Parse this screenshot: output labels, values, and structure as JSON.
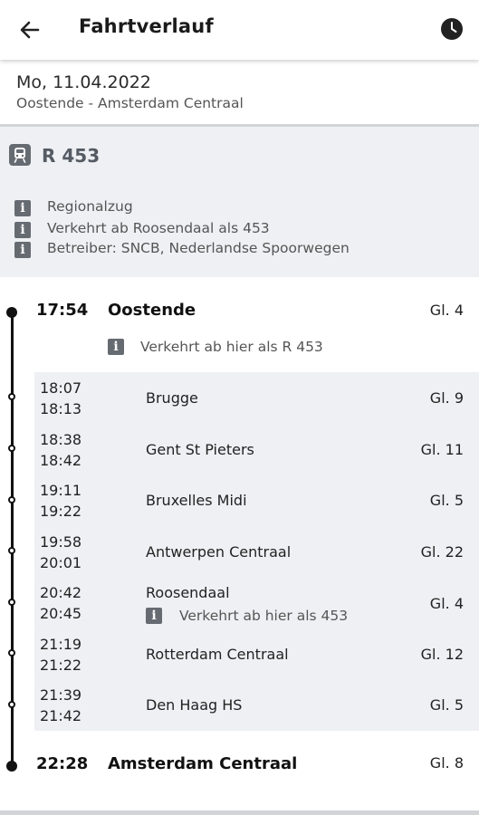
{
  "header": {
    "title": "Fahrtverlauf",
    "back_icon": "arrow-left-icon",
    "history_icon": "clock-icon"
  },
  "journey": {
    "date": "Mo, 11.04.2022",
    "route": "Oostende - Amsterdam Centraal"
  },
  "train": {
    "name": "R 453",
    "icon": "train-icon",
    "infos": [
      "Regionalzug",
      "Verkehrt ab Roosendaal als 453",
      "Betreiber: SNCB, Nederlandse Spoorwegen"
    ]
  },
  "origin": {
    "time": "17:54",
    "station": "Oostende",
    "track": "Gl. 4",
    "note": "Verkehrt ab hier als R 453"
  },
  "stops": [
    {
      "arr": "18:07",
      "dep": "18:13",
      "station": "Brugge",
      "track": "Gl. 9"
    },
    {
      "arr": "18:38",
      "dep": "18:42",
      "station": "Gent St Pieters",
      "track": "Gl. 11"
    },
    {
      "arr": "19:11",
      "dep": "19:22",
      "station": "Bruxelles Midi",
      "track": "Gl. 5"
    },
    {
      "arr": "19:58",
      "dep": "20:01",
      "station": "Antwerpen Centraal",
      "track": "Gl. 22"
    },
    {
      "arr": "20:42",
      "dep": "20:45",
      "station": "Roosendaal",
      "track": "Gl. 4",
      "note": "Verkehrt ab hier als 453"
    },
    {
      "arr": "21:19",
      "dep": "21:22",
      "station": "Rotterdam Centraal",
      "track": "Gl. 12"
    },
    {
      "arr": "21:39",
      "dep": "21:42",
      "station": "Den Haag HS",
      "track": "Gl. 5"
    }
  ],
  "destination": {
    "time": "22:28",
    "station": "Amsterdam Centraal",
    "track": "Gl. 8"
  },
  "info_icon_glyph": "i"
}
